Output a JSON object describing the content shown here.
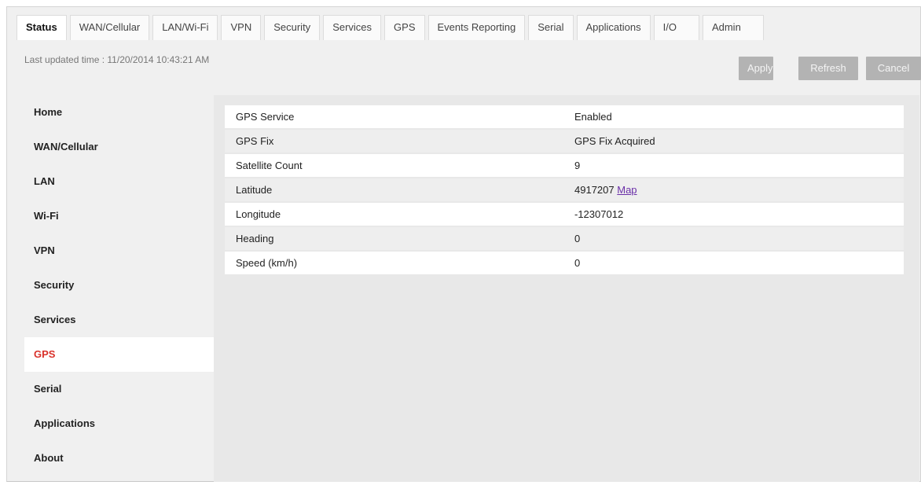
{
  "tabs": [
    {
      "label": "Status",
      "active": true
    },
    {
      "label": "WAN/Cellular"
    },
    {
      "label": "LAN/Wi-Fi"
    },
    {
      "label": "VPN"
    },
    {
      "label": "Security"
    },
    {
      "label": "Services"
    },
    {
      "label": "GPS"
    },
    {
      "label": "Events Reporting"
    },
    {
      "label": "Serial"
    },
    {
      "label": "Applications"
    },
    {
      "label": "I/O"
    },
    {
      "label": "Admin"
    }
  ],
  "header": {
    "updated_text": "Last updated time : 11/20/2014 10:43:21 AM"
  },
  "actions": {
    "apply": "Apply",
    "refresh": "Refresh",
    "cancel": "Cancel"
  },
  "sidebar": {
    "items": [
      {
        "label": "Home"
      },
      {
        "label": "WAN/Cellular"
      },
      {
        "label": "LAN"
      },
      {
        "label": "Wi-Fi"
      },
      {
        "label": "VPN"
      },
      {
        "label": "Security"
      },
      {
        "label": "Services"
      },
      {
        "label": "GPS",
        "active": true
      },
      {
        "label": "Serial"
      },
      {
        "label": "Applications"
      },
      {
        "label": "About"
      }
    ]
  },
  "gps_table": {
    "rows": [
      {
        "label": "GPS Service",
        "value": "Enabled"
      },
      {
        "label": "GPS Fix",
        "value": "GPS Fix Acquired"
      },
      {
        "label": "Satellite Count",
        "value": "9"
      },
      {
        "label": "Latitude",
        "value": "4917207",
        "link": "Map"
      },
      {
        "label": "Longitude",
        "value": "-12307012"
      },
      {
        "label": "Heading",
        "value": "0"
      },
      {
        "label": "Speed (km/h)",
        "value": "0"
      }
    ]
  },
  "colors": {
    "active_sidebar": "#d9322b",
    "link": "#6a2fa8",
    "button": "#b3b3b3"
  }
}
